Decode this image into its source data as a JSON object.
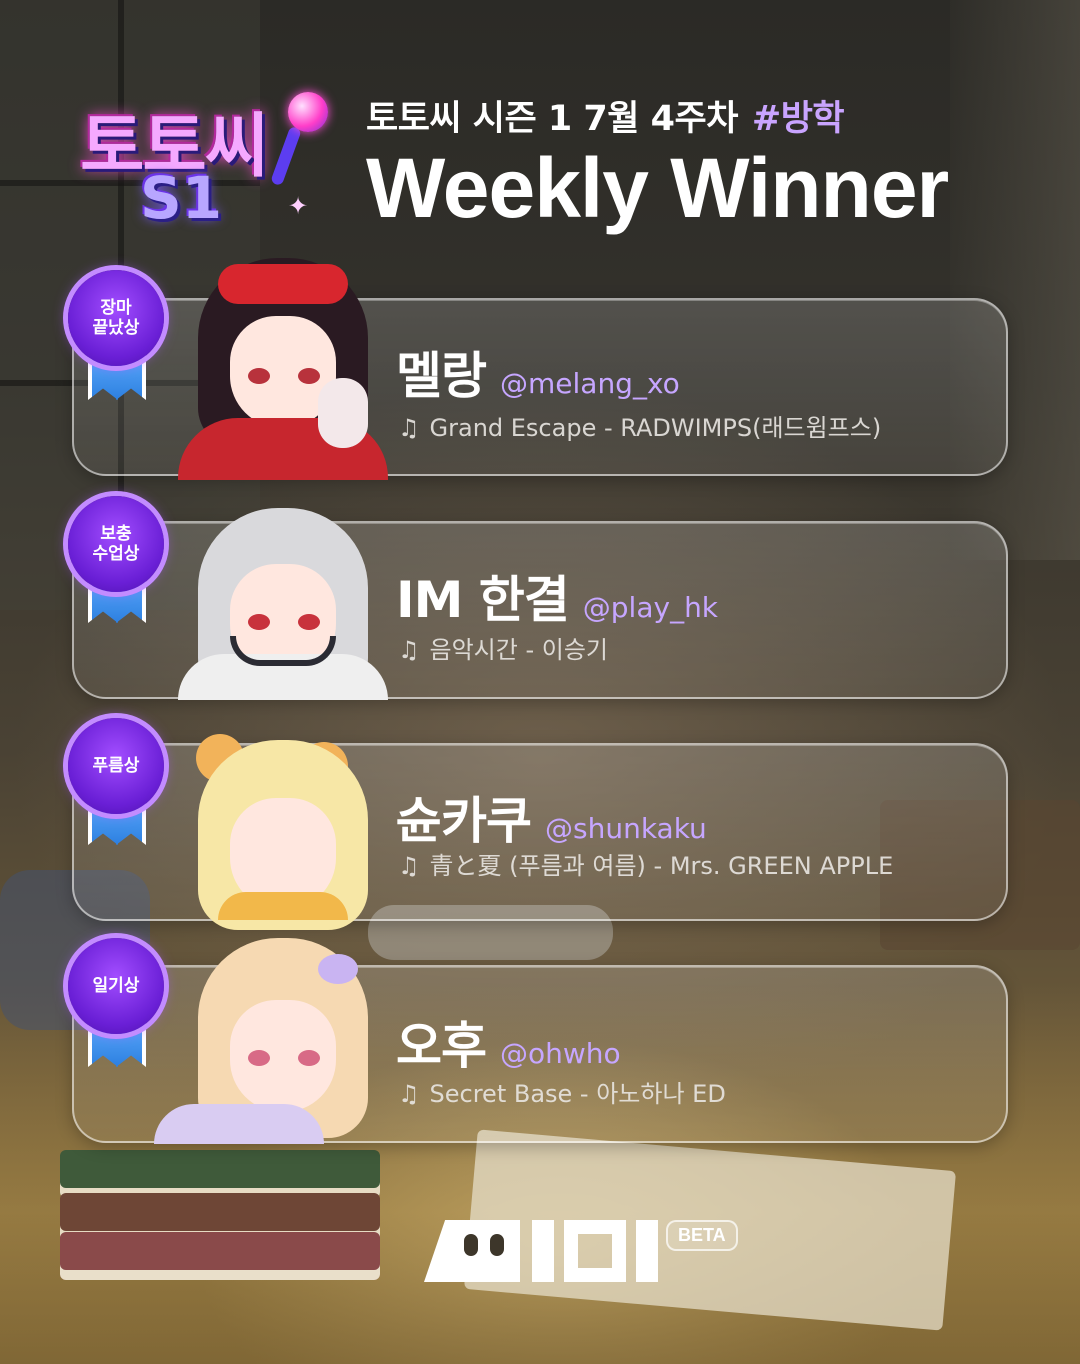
{
  "header": {
    "logo_text": "토토씨",
    "logo_sub": "S1",
    "subtitle": "토토씨 시즌 1 7월 4주차",
    "hashtag": "#방학",
    "title": "Weekly Winner"
  },
  "winners": [
    {
      "award": "장마\n끝났상",
      "name": "멜랑",
      "handle": "@melang_xo",
      "note_icon": "♫",
      "song": "Grand Escape - RADWIMPS(래드윔프스)"
    },
    {
      "award": "보충\n수업상",
      "name": "IM 한결",
      "handle": "@play_hk",
      "note_icon": "♫",
      "song": "음악시간 - 이승기"
    },
    {
      "award": "푸름상",
      "name": "슌카쿠",
      "handle": "@shunkaku",
      "note_icon": "♫",
      "song": "青と夏 (푸름과 여름) - Mrs. GREEN APPLE"
    },
    {
      "award": "일기상",
      "name": "오후",
      "handle": "@ohwho",
      "note_icon": "♫",
      "song": "Secret Base - 아노하나 ED"
    }
  ],
  "footer": {
    "brand": "MIDI",
    "badge": "BETA"
  },
  "colors": {
    "accent": "#c6a6ff",
    "medal": "#7a2fe6",
    "ribbon": "#3a8ef0"
  }
}
